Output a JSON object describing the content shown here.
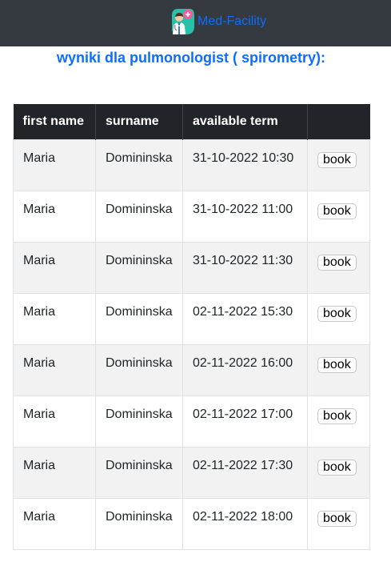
{
  "navbar": {
    "brand_name": "Med-Facility",
    "logo_icon": "doctor-logo-icon"
  },
  "page": {
    "title": "wyniki dla pulmonologist ( spirometry):"
  },
  "table": {
    "headers": [
      "first name",
      "surname",
      "available term",
      ""
    ],
    "rows": [
      {
        "first_name": "Maria",
        "surname": "Domininska",
        "term": "31-10-2022 10:30",
        "action": "book"
      },
      {
        "first_name": "Maria",
        "surname": "Domininska",
        "term": "31-10-2022 11:00",
        "action": "book"
      },
      {
        "first_name": "Maria",
        "surname": "Domininska",
        "term": "31-10-2022 11:30",
        "action": "book"
      },
      {
        "first_name": "Maria",
        "surname": "Domininska",
        "term": "02-11-2022 15:30",
        "action": "book"
      },
      {
        "first_name": "Maria",
        "surname": "Domininska",
        "term": "02-11-2022 16:00",
        "action": "book"
      },
      {
        "first_name": "Maria",
        "surname": "Domininska",
        "term": "02-11-2022 17:00",
        "action": "book"
      },
      {
        "first_name": "Maria",
        "surname": "Domininska",
        "term": "02-11-2022 17:30",
        "action": "book"
      },
      {
        "first_name": "Maria",
        "surname": "Domininska",
        "term": "02-11-2022 18:00",
        "action": "book"
      }
    ]
  },
  "colors": {
    "navbar_bg": "#343a40",
    "accent": "#0d6efd",
    "table_header_bg": "#212529",
    "striped_row_bg": "#f2f2f2"
  }
}
